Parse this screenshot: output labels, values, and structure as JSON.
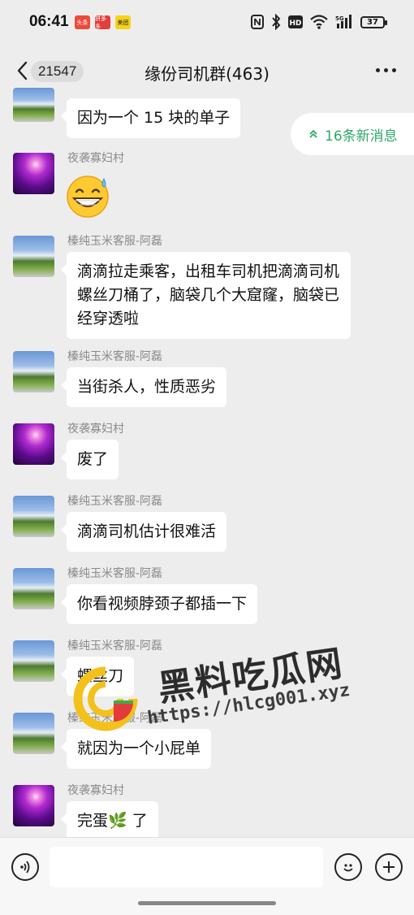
{
  "status_bar": {
    "time": "06:41",
    "notif_apps": [
      "头条",
      "拼多多",
      "美团"
    ],
    "battery": "37",
    "signal_label": "5G"
  },
  "nav": {
    "unread_count": "21547",
    "title": "缘份司机群(463)"
  },
  "new_messages_pill": "16条新消息",
  "messages": [
    {
      "sender": "",
      "text": "因为一个 15 块的单子",
      "avatar": "landscape"
    },
    {
      "sender": "夜袭寡妇村",
      "text": "😅",
      "avatar": "night"
    },
    {
      "sender": "榛纯玉米客服-阿磊",
      "text": "滴滴拉走乘客，出租车司机把滴滴司机螺丝刀桶了，脑袋几个大窟窿，脑袋已经穿透啦",
      "avatar": "landscape"
    },
    {
      "sender": "榛纯玉米客服-阿磊",
      "text": "当街杀人，性质恶劣",
      "avatar": "landscape"
    },
    {
      "sender": "夜袭寡妇村",
      "text": "废了",
      "avatar": "night"
    },
    {
      "sender": "榛纯玉米客服-阿磊",
      "text": "滴滴司机估计很难活",
      "avatar": "landscape"
    },
    {
      "sender": "榛纯玉米客服-阿磊",
      "text": "你看视频脖颈子都插一下",
      "avatar": "landscape"
    },
    {
      "sender": "榛纯玉米客服-阿磊",
      "text": "螺丝刀",
      "avatar": "landscape"
    },
    {
      "sender": "榛纯玉米客服-阿磊",
      "text": "就因为一个小屁单",
      "avatar": "landscape"
    },
    {
      "sender": "夜袭寡妇村",
      "text": "完蛋🌿 了",
      "avatar": "night"
    }
  ],
  "watermark": {
    "title": "黑料吃瓜网",
    "url": "https://hlcg001.xyz"
  },
  "input": {
    "placeholder": "",
    "value": ""
  },
  "icons": {
    "back": "chevron-left-icon",
    "more": "more-dots-icon",
    "voice": "voice-icon",
    "emoji": "emoji-icon",
    "plus": "plus-icon"
  },
  "colors": {
    "accent_green": "#2fa86a",
    "chat_background": "#ededed",
    "bubble": "#ffffff"
  }
}
